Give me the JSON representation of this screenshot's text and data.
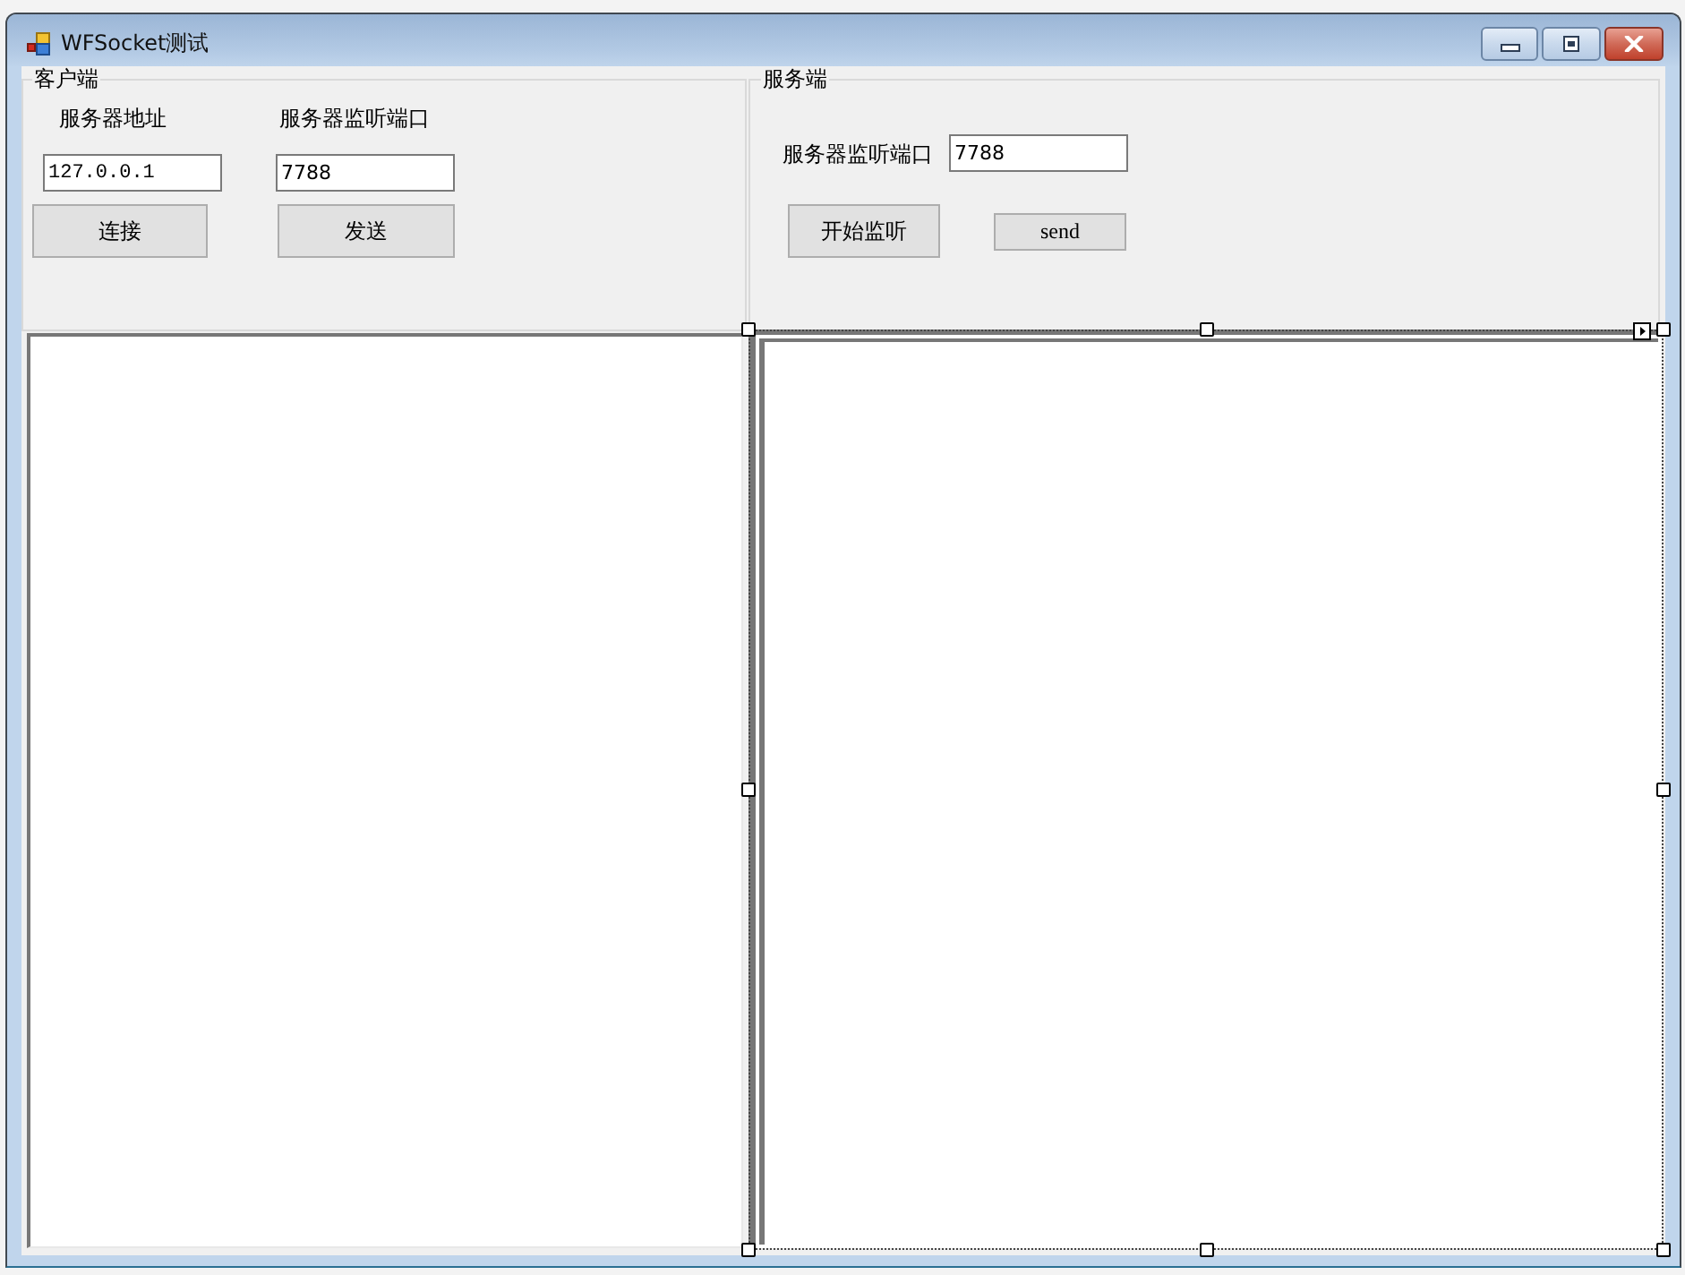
{
  "window": {
    "title": "WFSocket测试"
  },
  "client_group": {
    "title": "客户端",
    "address_label": "服务器地址",
    "port_label": "服务器监听端口",
    "address_field": {
      "value": "127.0.0.1"
    },
    "port_field": {
      "value": "7788"
    },
    "buttons": [
      "连接",
      "发送"
    ]
  },
  "server_group": {
    "title": "服务端",
    "port_label": "服务器监听端口",
    "port_field": {
      "value": "7788"
    },
    "buttons": [
      "开始监听",
      "send"
    ]
  },
  "text_boxes": [
    {
      "selected": false
    },
    {
      "selected": true
    }
  ]
}
